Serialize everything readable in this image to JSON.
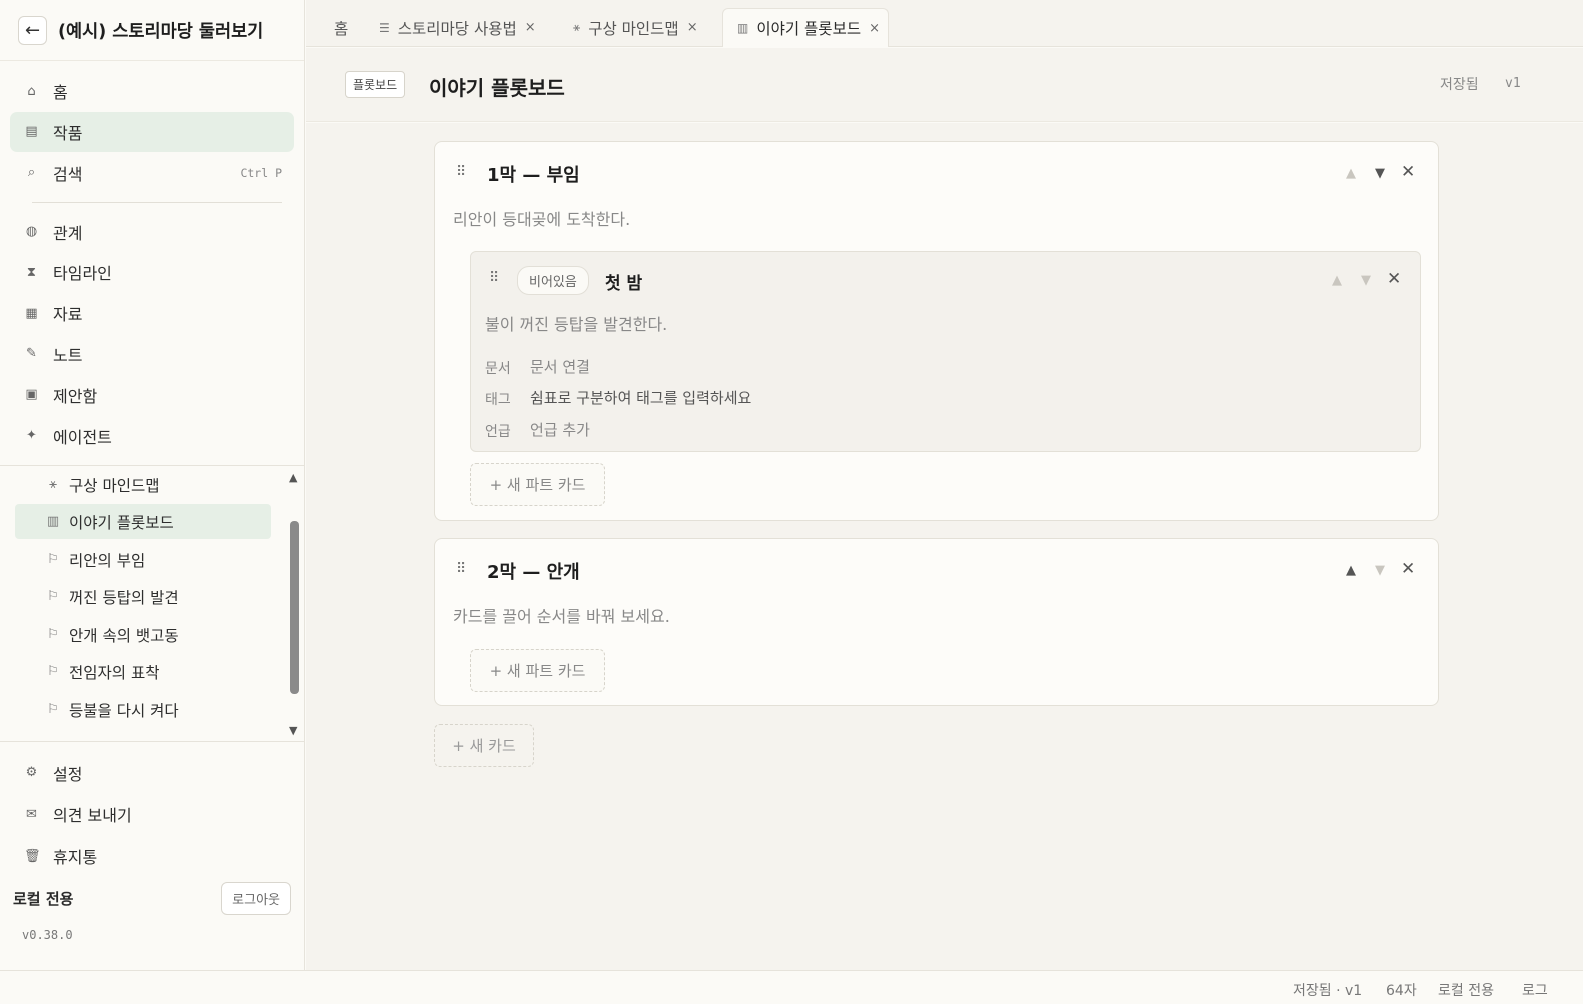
{
  "sidebar": {
    "title": "(예시) 스토리마당 둘러보기",
    "back_icon": "←",
    "nav": [
      {
        "label": "홈",
        "icon": "⌂"
      },
      {
        "label": "작품",
        "icon": "▤"
      },
      {
        "label": "검색",
        "icon": "⌕",
        "shortcut": "Ctrl P"
      }
    ],
    "nav2": [
      {
        "label": "관계",
        "icon": "◍"
      },
      {
        "label": "타임라인",
        "icon": "⧗"
      },
      {
        "label": "자료",
        "icon": "▦"
      },
      {
        "label": "노트",
        "icon": "✎"
      },
      {
        "label": "제안함",
        "icon": "▣"
      },
      {
        "label": "에이전트",
        "icon": "✦"
      }
    ],
    "tree": [
      {
        "label": "구상 마인드맵",
        "icon": "⚹"
      },
      {
        "label": "이야기 플롯보드",
        "icon": "▥"
      },
      {
        "label": "리안의 부임",
        "icon": "⚐"
      },
      {
        "label": "꺼진 등탑의 발견",
        "icon": "⚐"
      },
      {
        "label": "안개 속의 뱃고동",
        "icon": "⚐"
      },
      {
        "label": "전임자의 표착",
        "icon": "⚐"
      },
      {
        "label": "등불을 다시 켜다",
        "icon": "⚐"
      }
    ],
    "bottom": [
      {
        "label": "설정",
        "icon": "⚙"
      },
      {
        "label": "의견 보내기",
        "icon": "✉"
      },
      {
        "label": "휴지통",
        "icon": "🗑"
      }
    ],
    "local_label": "로컬 전용",
    "logout": "로그아웃",
    "version": "v0.38.0"
  },
  "tabs": [
    {
      "label": "홈",
      "icon": ""
    },
    {
      "label": "스토리마당 사용법",
      "icon": "☰",
      "close": "×"
    },
    {
      "label": "구상 마인드맵",
      "icon": "⚹",
      "close": "×"
    },
    {
      "label": "이야기 플롯보드",
      "icon": "▥",
      "close": "×"
    }
  ],
  "header": {
    "badge": "플롯보드",
    "title": "이야기 플롯보드",
    "saved": "저장됨",
    "version": "v1"
  },
  "cards": [
    {
      "title": "1막 — 부임",
      "desc": "리안이 등대곶에 도착한다.",
      "part": {
        "chip": "비어있음",
        "title": "첫 밤",
        "desc": "불이 꺼진 등탑을 발견한다.",
        "doc_label": "문서",
        "doc_value": "문서 연결",
        "tag_label": "태그",
        "tag_placeholder": "쉼표로 구분하여 태그를 입력하세요",
        "mention_label": "언급",
        "mention_value": "언급 추가"
      },
      "add_part": "+ 새 파트 카드"
    },
    {
      "title": "2막 — 안개",
      "desc": "카드를 끌어 순서를 바꿔 보세요.",
      "add_part": "+ 새 파트 카드"
    }
  ],
  "add_card": "+ 새 카드",
  "status": {
    "saved": "저장됨 · v1",
    "chars": "64자",
    "local": "로컬 전용",
    "log": "로그"
  },
  "icons": {
    "grip": "⠿",
    "up": "▲",
    "down": "▼",
    "close": "✕"
  }
}
